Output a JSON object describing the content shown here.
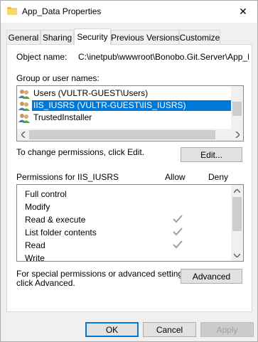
{
  "window": {
    "title": "App_Data Properties",
    "close_glyph": "✕"
  },
  "tabs": [
    {
      "label": "General",
      "active": false
    },
    {
      "label": "Sharing",
      "active": false
    },
    {
      "label": "Security",
      "active": true
    },
    {
      "label": "Previous Versions",
      "active": false
    },
    {
      "label": "Customize",
      "active": false
    }
  ],
  "security": {
    "object_name_label": "Object name:",
    "object_name_value": "C:\\inetpub\\wwwroot\\Bonobo.Git.Server\\App_Data",
    "groups_label": "Group or user names:",
    "users": [
      {
        "name": "Users (VULTR-GUEST\\Users)",
        "selected": false
      },
      {
        "name": "IIS_IUSRS (VULTR-GUEST\\IIS_IUSRS)",
        "selected": true
      },
      {
        "name": "TrustedInstaller",
        "selected": false
      }
    ],
    "change_text": "To change permissions, click Edit.",
    "edit_button": "Edit...",
    "permissions_for_label": "Permissions for IIS_IUSRS",
    "allow_header": "Allow",
    "deny_header": "Deny",
    "permissions": [
      {
        "name": "Full control",
        "allow": false,
        "deny": false
      },
      {
        "name": "Modify",
        "allow": false,
        "deny": false
      },
      {
        "name": "Read & execute",
        "allow": true,
        "deny": false
      },
      {
        "name": "List folder contents",
        "allow": true,
        "deny": false
      },
      {
        "name": "Read",
        "allow": true,
        "deny": false
      },
      {
        "name": "Write",
        "allow": false,
        "deny": false
      }
    ],
    "special_text_line1": "For special permissions or advanced settings,",
    "special_text_line2": "click Advanced.",
    "advanced_button": "Advanced"
  },
  "footer": {
    "ok": "OK",
    "cancel": "Cancel",
    "apply": "Apply"
  },
  "colors": {
    "selection": "#0078d7",
    "check_inherited": "#a0a0a0"
  },
  "icons": {
    "folder": "folder-icon",
    "user_group": "user-group-icon",
    "check": "check-icon"
  }
}
